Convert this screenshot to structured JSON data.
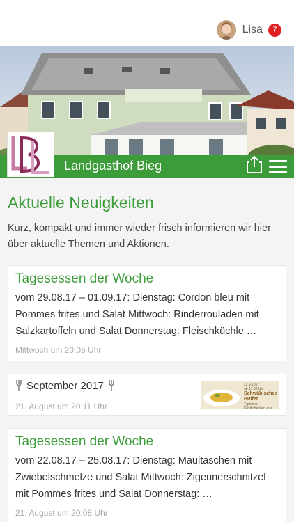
{
  "user": {
    "name": "Lisa",
    "notifications": "7"
  },
  "header": {
    "place_name": "Landgasthof Bieg",
    "logo_text": "LBL"
  },
  "section": {
    "title": "Aktuelle Neuigkeiten",
    "intro": "Kurz, kompakt und immer wieder frisch informieren wir hier über aktuelle Themen und Aktionen."
  },
  "posts": [
    {
      "title": "Tagesessen der Woche",
      "body": "vom 29.08.17 – 01.09.17: Dienstag: Cordon bleu mit Pommes frites und Salat Mittwoch: Rinderrouladen mit Salzkartoffeln und Salat Donnerstag: Fleischküchle …",
      "time": "Mittwoch um 20:05 Uhr"
    },
    {
      "title": "September 2017",
      "time": "21. August um 20:11 Uhr",
      "thumb": {
        "date": "22.9.2017",
        "line1": "ab 17.30 Uhr",
        "line2": "Schwäbisches",
        "line3": "Buffet",
        "line4": "Typische Köstlichkeiten aus der Schwäbischen"
      }
    },
    {
      "title": "Tagesessen der Woche",
      "body": "vom 22.08.17 – 25.08.17: Dienstag: Maultaschen mit Zwiebelschmelze und Salat Mittwoch: Zigeunerschnitzel mit Pommes frites und Salat Donnerstag: …",
      "time": "21. August um 20:08 Uhr"
    }
  ],
  "colors": {
    "accent": "#3d9c3a",
    "badge": "#e02020"
  }
}
